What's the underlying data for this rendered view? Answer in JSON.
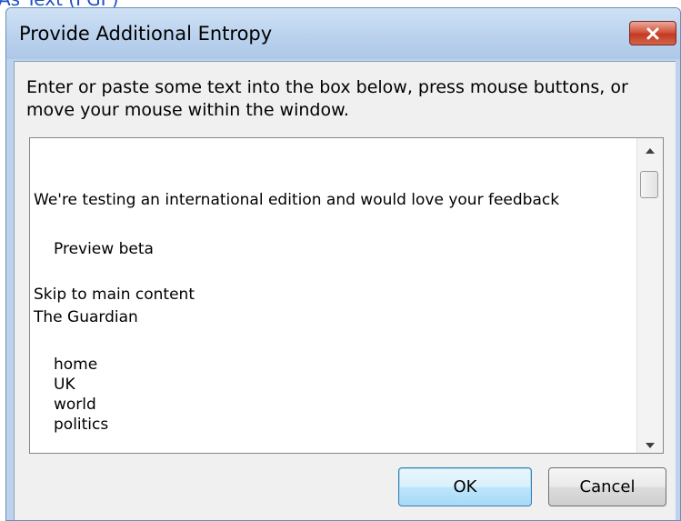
{
  "caption": "As Text (PGP)",
  "window": {
    "title": "Provide Additional Entropy"
  },
  "prompt": "Enter or paste some text into the box below, press mouse buttons, or move your mouse within the window.",
  "textbox": {
    "lines": [
      "We're testing an international edition and would love your feedback",
      "Preview beta",
      "Skip to main content",
      "The Guardian",
      "home",
      "UK",
      "world",
      "politics"
    ]
  },
  "buttons": {
    "ok": "OK",
    "cancel": "Cancel"
  },
  "icons": {
    "close": "close-icon",
    "scroll_up": "chevron-up-icon",
    "scroll_down": "chevron-down-icon"
  }
}
